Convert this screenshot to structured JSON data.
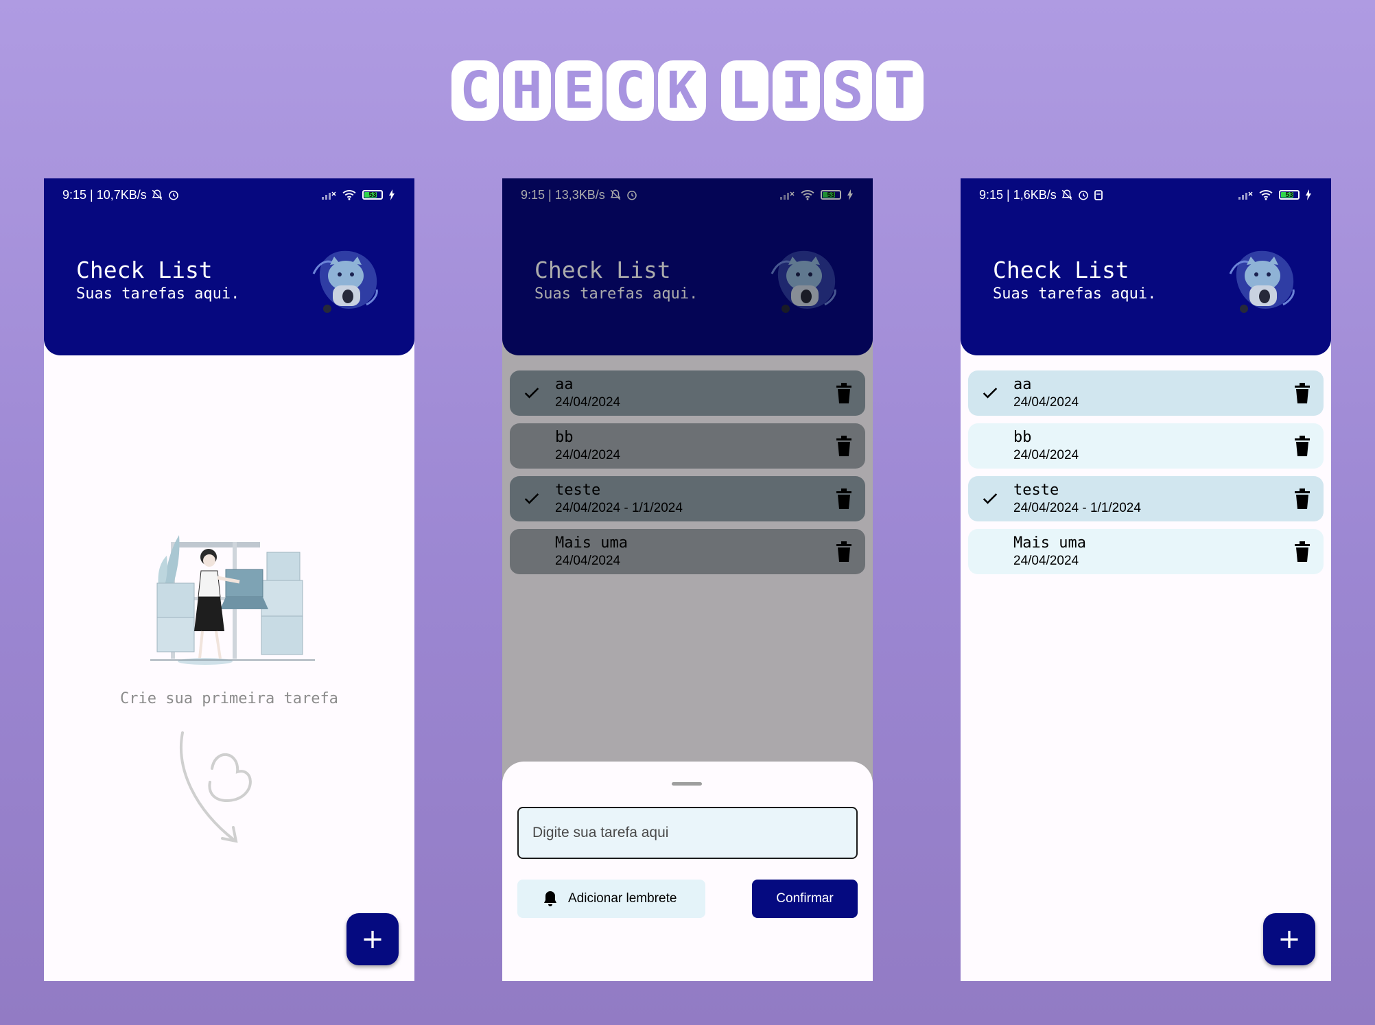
{
  "banner": {
    "letters": [
      "C",
      "H",
      "E",
      "C",
      "K",
      "",
      "L",
      "I",
      "S",
      "T"
    ]
  },
  "app": {
    "title": "Check List",
    "subtitle": "Suas tarefas aqui."
  },
  "colors": {
    "header": "#06087f",
    "fab": "#050a80",
    "accent_check": "#a894e0",
    "battery": "#31d64b"
  },
  "phones": [
    {
      "status": {
        "time": "9:15 | 10,7KB/s",
        "battery": "53"
      }
    },
    {
      "status": {
        "time": "9:15 | 13,3KB/s",
        "battery": "53"
      }
    },
    {
      "status": {
        "time": "9:15 | 1,6KB/s",
        "battery": "53"
      }
    }
  ],
  "empty_state": {
    "message": "Crie sua primeira tarefa"
  },
  "fab": {
    "label": "+"
  },
  "tasks": [
    {
      "name": "aa",
      "date": "24/04/2024",
      "done": true
    },
    {
      "name": "bb",
      "date": "24/04/2024",
      "done": false
    },
    {
      "name": "teste",
      "date": "24/04/2024 - 1/1/2024",
      "done": true
    },
    {
      "name": "Mais uma",
      "date": "24/04/2024",
      "done": false
    }
  ],
  "sheet": {
    "input_placeholder": "Digite sua tarefa aqui",
    "reminder_label": "Adicionar lembrete",
    "confirm_label": "Confirmar"
  }
}
